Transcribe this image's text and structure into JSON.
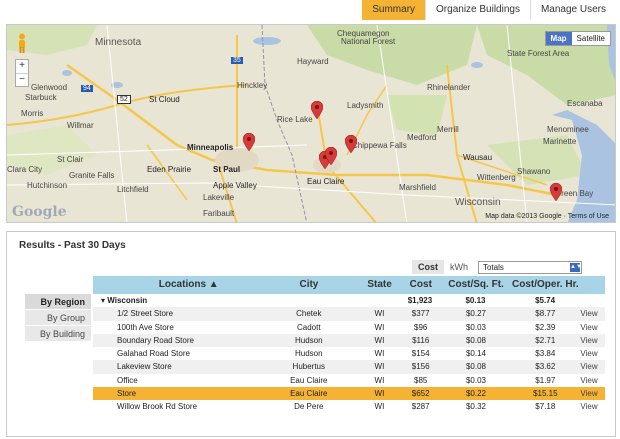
{
  "top_tabs": [
    {
      "label": "Summary",
      "active": true
    },
    {
      "label": "Organize Buildings",
      "active": false
    },
    {
      "label": "Manage Users",
      "active": false
    }
  ],
  "map": {
    "type_buttons": [
      {
        "label": "Map",
        "selected": true
      },
      {
        "label": "Satellite",
        "selected": false
      }
    ],
    "zoom_in": "+",
    "zoom_out": "−",
    "logo": "Google",
    "attribution": "Map data ©2013 Google · Terms of Use",
    "labels": {
      "minnesota": "Minnesota",
      "chequamegon": "Chequamegon",
      "national_forest": "National Forest",
      "st_cloud": "St Cloud",
      "minneapolis": "Minneapolis",
      "st_paul": "St Paul",
      "eden_prairie": "Eden Prairie",
      "apple_valley": "Apple Valley",
      "lakeville": "Lakeville",
      "faribault": "Faribault",
      "eau_claire": "Eau Claire",
      "chippewa_falls": "Chippewa Falls",
      "ladysmith": "Ladysmith",
      "medford": "Medford",
      "merrill": "Merrill",
      "wausau": "Wausau",
      "marshfield": "Marshfield",
      "wisconsin": "Wisconsin",
      "green_bay": "Green Bay",
      "rhinelander": "Rhinelander",
      "hinckley": "Hinckley",
      "glenwood": "Glenwood",
      "starbuck": "Starbuck",
      "morris": "Morris",
      "willmar": "Willmar",
      "st_clair": "St Clair",
      "clara_city": "Clara City",
      "litchfield": "Litchfield",
      "granite_falls": "Granite Falls",
      "hutchinson": "Hutchinson",
      "rice_lake": "Rice Lake",
      "shawano": "Shawano",
      "wittenberg": "Wittenberg",
      "menominee": "Menominee",
      "escanaba": "Escanaba",
      "marinette": "Marinette",
      "state_forest": "State Forest Area",
      "hayward": "Hayward",
      "route_35": "35",
      "route_94": "94",
      "route_52": "52"
    },
    "colors": {
      "land": "#e9e5d4",
      "forest": "#c9dca8",
      "water": "#a9c3e0",
      "road": "#f6c64a",
      "pin": "#d83a3a"
    }
  },
  "results": {
    "title": "Results - Past 30 Days",
    "metric_tabs": [
      {
        "label": "Cost",
        "selected": true
      },
      {
        "label": "kWh",
        "selected": false
      }
    ],
    "totals_select": "Totals",
    "group_tabs": [
      {
        "label": "By Region",
        "selected": true
      },
      {
        "label": "By Group",
        "selected": false
      },
      {
        "label": "By Building",
        "selected": false
      }
    ],
    "headers": {
      "location": "Locations ▲",
      "city": "City",
      "state": "State",
      "cost": "Cost",
      "cost_sqft": "Cost/Sq. Ft.",
      "cost_oper": "Cost/Oper. Hr."
    },
    "region": {
      "name": "▾ Wisconsin",
      "cost": "$1,923",
      "cost_sqft": "$0.13",
      "cost_oper": "$5.74"
    },
    "view_label": "View",
    "rows": [
      {
        "location": "1/2 Street Store",
        "city": "Chetek",
        "state": "WI",
        "cost": "$377",
        "cost_sqft": "$0.27",
        "cost_oper": "$8.77",
        "view": "View"
      },
      {
        "location": "100th Ave Store",
        "city": "Cadott",
        "state": "WI",
        "cost": "$96",
        "cost_sqft": "$0.03",
        "cost_oper": "$2.39",
        "view": "View"
      },
      {
        "location": "Boundary Road Store",
        "city": "Hudson",
        "state": "WI",
        "cost": "$116",
        "cost_sqft": "$0.08",
        "cost_oper": "$2.71",
        "view": "View"
      },
      {
        "location": "Galahad Road Store",
        "city": "Hudson",
        "state": "WI",
        "cost": "$154",
        "cost_sqft": "$0.14",
        "cost_oper": "$3.84",
        "view": "View"
      },
      {
        "location": "Lakeview Store",
        "city": "Hubertus",
        "state": "WI",
        "cost": "$156",
        "cost_sqft": "$0.08",
        "cost_oper": "$3.62",
        "view": "View"
      },
      {
        "location": "Office",
        "city": "Eau Claire",
        "state": "WI",
        "cost": "$85",
        "cost_sqft": "$0.03",
        "cost_oper": "$1.97",
        "view": "View"
      },
      {
        "location": "Store",
        "city": "Eau Claire",
        "state": "WI",
        "cost": "$652",
        "cost_sqft": "$0.22",
        "cost_oper": "$15.15",
        "view": "View",
        "highlight": true
      },
      {
        "location": "Willow Brook Rd Store",
        "city": "De Pere",
        "state": "WI",
        "cost": "$287",
        "cost_sqft": "$0.32",
        "cost_oper": "$7.18",
        "view": "View"
      }
    ],
    "highlight_color": "#f5b335",
    "header_color": "#a8d4e8"
  }
}
